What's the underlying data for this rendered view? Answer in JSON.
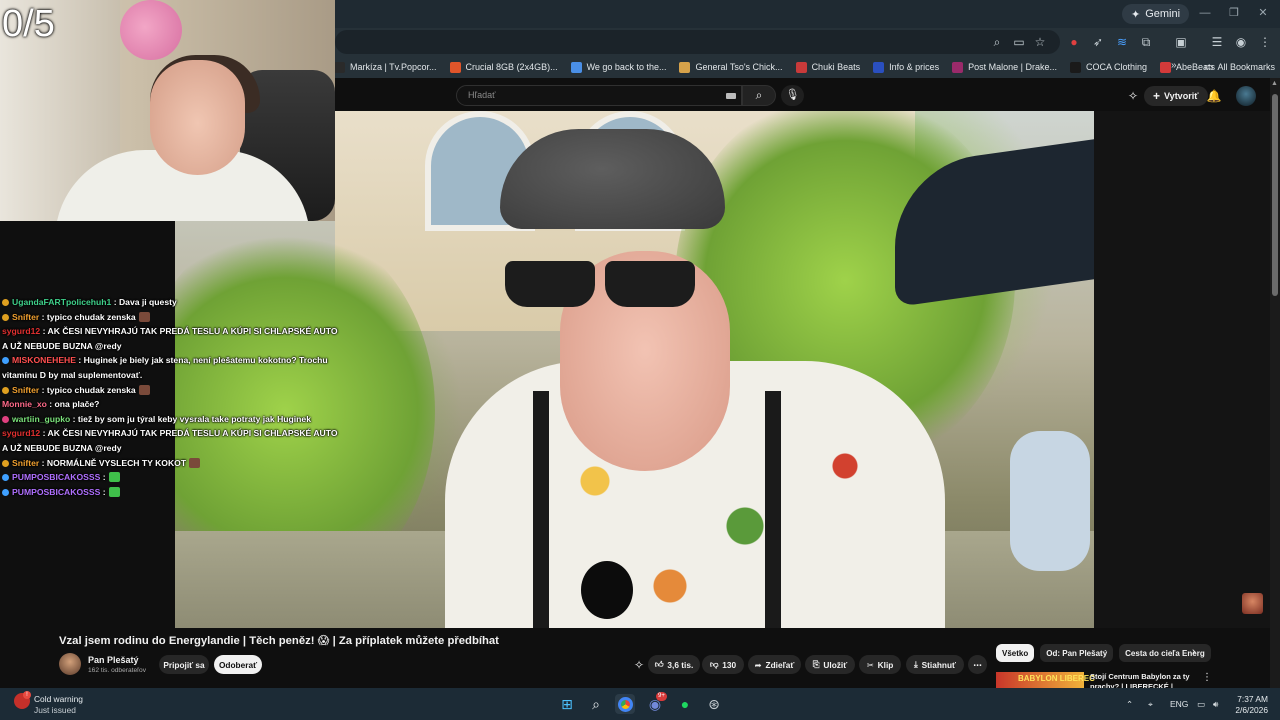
{
  "stream_overlay": {
    "counter": "0/5"
  },
  "browser": {
    "gemini_label": "Gemini",
    "bookmarks": [
      {
        "label": "Markíza | Tv.Popcor...",
        "color": "#2a2a2a"
      },
      {
        "label": "Crucial 8GB (2x4GB)...",
        "color": "#e0552a"
      },
      {
        "label": "We go back to the...",
        "color": "#4a8fe6"
      },
      {
        "label": "General Tso's Chick...",
        "color": "#d6a24a"
      },
      {
        "label": "Chuki Beats",
        "color": "#c83a3a"
      },
      {
        "label": "Info & prices",
        "color": "#2a4fbf"
      },
      {
        "label": "Post Malone | Drake...",
        "color": "#9a2a6a"
      },
      {
        "label": "COCA Clothing",
        "color": "#1a1a1a"
      },
      {
        "label": "AbeBeats",
        "color": "#d23a3a"
      }
    ],
    "all_bookmarks_label": "All Bookmarks"
  },
  "youtube": {
    "search_placeholder": "Hľadať",
    "create_label": "Vytvoriť",
    "video_title": "Vzal jsem rodinu do Energylandie | Těch peněz! 😱 | Za příplatek můžete předbíhat",
    "channel_name": "Pan Plešatý",
    "channel_subs": "162 tis. odberateľov",
    "join_label": "Pripojiť sa",
    "subscribe_label": "Odoberať",
    "like_count": "3,6 tis.",
    "dislike_count": "130",
    "share_label": "Zdieľať",
    "save_label": "Uložiť",
    "clip_label": "Klip",
    "download_label": "Stiahnuť",
    "chips": [
      "Všetko",
      "Od: Pan Plešatý",
      "Cesta do cieľa Energ"
    ],
    "rec_title": "Stojí Centrum Babylon za ty prachy? | LIBERECKÉ | Aquapa...",
    "rec_thumb_text": "BABYLON LIBEREC"
  },
  "chat": [
    {
      "user": "UgandaFARTpolicehuh1",
      "user_color": "#3fd08a",
      "text": ": Dava ji questy",
      "emote": false,
      "badge": "#e0a020"
    },
    {
      "user": "Snifter",
      "user_color": "#f0a030",
      "text": ": typico chudak zenska",
      "emote": true,
      "badge": "#e0a020"
    },
    {
      "user": "sygurd12",
      "user_color": "#e03030",
      "text": ": AK ČESI NEVYHRAJÚ TAK PREDÁ TESLU A KÚPI SI CHLAPSKÉ AUTO A UŽ NEBUDE BUZNA @redy",
      "emote": false,
      "badge": null
    },
    {
      "user": "MISKONEHEHE",
      "user_color": "#ff5050",
      "text": ": Huginek je biely jak stena, není plešatemu kokotno? Trochu vitamínu D by mal suplementovať.",
      "emote": false,
      "badge": "#3fa0ff"
    },
    {
      "user": "Snifter",
      "user_color": "#f0a030",
      "text": ": typico chudak zenska",
      "emote": true,
      "badge": "#e0a020"
    },
    {
      "user": "Monnie_xo",
      "user_color": "#ff6a8a",
      "text": ": ona plače?",
      "emote": false,
      "badge": null
    },
    {
      "user": "wartiin_gupko",
      "user_color": "#7ae07a",
      "text": ": tiež by som ju týral keby vysrala take potraty jak Huginek",
      "emote": false,
      "badge": "#e04080"
    },
    {
      "user": "sygurd12",
      "user_color": "#e03030",
      "text": ": AK ČESI NEVYHRAJÚ TAK PREDÁ TESLU A KÚPI SI CHLAPSKÉ AUTO A UŽ NEBUDE BUZNA @redy",
      "emote": false,
      "badge": null
    },
    {
      "user": "Snifter",
      "user_color": "#f0a030",
      "text": ": NORMÁLNĚ VYSLECH TY KOKOT",
      "emote": true,
      "badge": "#e0a020"
    },
    {
      "user": "PUMPOSBICAKOSSS",
      "user_color": "#b070ff",
      "text": ":",
      "emote": true,
      "badge": "#3fa0ff"
    },
    {
      "user": "PUMPOSBICAKOSSS",
      "user_color": "#b070ff",
      "text": ":",
      "emote": true,
      "badge": "#3fa0ff"
    }
  ],
  "taskbar": {
    "weather_title": "Cold warning",
    "weather_sub": "Just issued",
    "lang": "ENG",
    "time": "7:37 AM",
    "date": "2/6/2026",
    "discord_badge": "9+"
  }
}
